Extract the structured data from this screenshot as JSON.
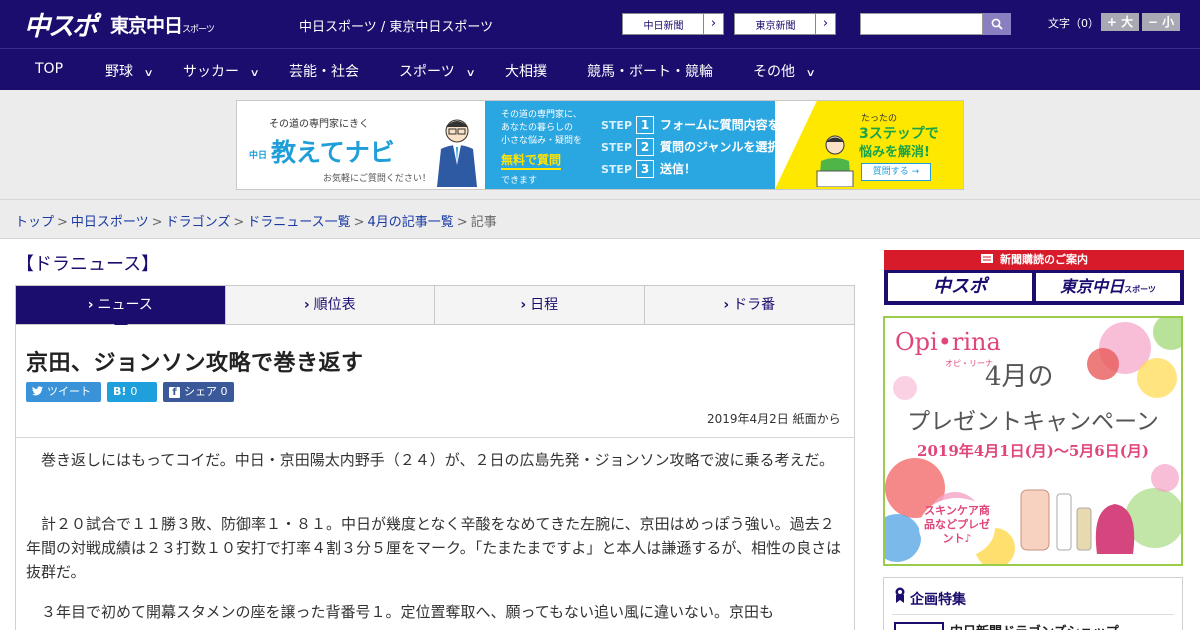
{
  "header": {
    "logo_main": "中スポ",
    "logo_tokyo": "東京中日",
    "logo_tokyo_sub": "スポーツ",
    "site_name": "中日スポーツ / 東京中日スポーツ",
    "link_chunichi": "中日新聞",
    "link_tokyo": "東京新聞",
    "link_arrow": "›",
    "search_placeholder": "",
    "font_label": "文字（0）",
    "font_larger": "+ 大",
    "font_smaller": "− 小"
  },
  "nav": {
    "items": [
      {
        "label": "TOP"
      },
      {
        "label": "野球",
        "chevron": "∨"
      },
      {
        "label": "サッカー",
        "chevron": "∨"
      },
      {
        "label": "芸能・社会"
      },
      {
        "label": "スポーツ",
        "chevron": "∨"
      },
      {
        "label": "大相撲"
      },
      {
        "label": "競馬・ボート・競輪"
      },
      {
        "label": "その他",
        "chevron": "∨"
      }
    ]
  },
  "banner": {
    "small_top": "その道の専門家にきく",
    "brand_prefix": "中日",
    "brand": "教えてナビ",
    "caption": "お気軽にご質問ください！",
    "mid_text_1": "その道の専門家に、",
    "mid_text_2": "あなたの暮らしの",
    "mid_text_3": "小さな悩み・疑問を",
    "mid_free": "無料で質問",
    "mid_can": "できます",
    "steps": [
      {
        "step": "STEP",
        "num": "1",
        "text": "フォームに質問内容を入力"
      },
      {
        "step": "STEP",
        "num": "2",
        "text": "質問のジャンルを選択"
      },
      {
        "step": "STEP",
        "num": "3",
        "text": "送信！"
      }
    ],
    "right_1": "たったの",
    "right_2": "3ステップで",
    "right_3": "悩みを解消!",
    "right_button": "質問する →"
  },
  "breadcrumb": {
    "items": [
      "トップ",
      "中日スポーツ",
      "ドラゴンズ",
      "ドラニュース一覧",
      "4月の記事一覧"
    ],
    "current": "記事",
    "separator": ">"
  },
  "section": {
    "title": "【ドラニュース】"
  },
  "tabs": [
    {
      "label": "ニュース",
      "chevron": "›"
    },
    {
      "label": "順位表",
      "chevron": "›"
    },
    {
      "label": "日程",
      "chevron": "›"
    },
    {
      "label": "ドラ番",
      "chevron": "›"
    }
  ],
  "article": {
    "headline": "京田、ジョンソン攻略で巻き返す",
    "share_tweet": "ツイート",
    "share_hatena_icon": "B!",
    "share_hatena_count": "0",
    "share_fb_icon": "f",
    "share_fb_label": "シェア 0",
    "date": "2019年4月2日 紙面から",
    "paragraphs": [
      "巻き返しにはもってコイだ。中日・京田陽太内野手（２４）が、２日の広島先発・ジョンソン攻略で波に乗る考えだ。",
      "計２０試合で１１勝３敗、防御率１・８１。中日が幾度となく辛酸をなめてきた左腕に、京田はめっぽう強い。過去２年間の対戦成績は２３打数１０安打で打率４割３分５厘をマーク。「たまたまですよ」と本人は謙遜するが、相性の良さは抜群だ。",
      "３年目で初めて開幕スタメンの座を譲った背番号１。定位置奪取へ、願ってもない追い風に違いない。京田も"
    ]
  },
  "sidebar": {
    "subscribe_title": "新聞購読のご案内",
    "subscribe_logo_1": "中スポ",
    "subscribe_logo_2": "東京中日",
    "subscribe_logo_2_sub": "スポーツ",
    "promo_brand": "Opi•rina",
    "promo_kana": "オピ・リーナ",
    "promo_month": "4月の",
    "promo_campaign": "プレゼントキャンペーン",
    "promo_dates": "2019年4月1日(月)～5月6日(月)",
    "promo_bubble": "スキンケア商品などプレゼント♪",
    "feature_title": "企画特集",
    "feature_item": "中日新聞ドラゴンズショップ"
  },
  "colors": {
    "brand_navy": "#1a0d6e",
    "accent_red": "#d81b2b",
    "link_blue": "#1a3aa3",
    "twitter": "#3a93d8",
    "hatena": "#1fa0dc",
    "facebook": "#3b5998"
  },
  "icons": {
    "search": "magnifier-icon",
    "tweet": "twitter-bird-icon",
    "hatena": "hatena-bookmark-icon",
    "facebook": "facebook-f-icon",
    "feature": "ribbon-icon"
  }
}
